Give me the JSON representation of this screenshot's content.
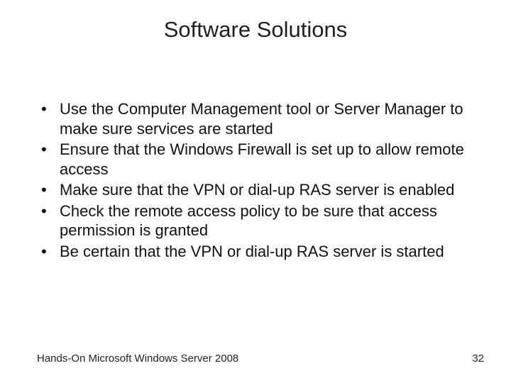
{
  "title": "Software Solutions",
  "bullets": [
    "Use the Computer Management tool or Server Manager to make sure services are started",
    "Ensure that the Windows Firewall is set up to allow remote access",
    "Make sure that the VPN or dial-up RAS server is enabled",
    "Check the remote access policy to be sure that access permission is granted",
    "Be certain that the VPN or dial-up RAS server is started"
  ],
  "footer": {
    "left": "Hands-On Microsoft Windows Server 2008",
    "page": "32"
  }
}
